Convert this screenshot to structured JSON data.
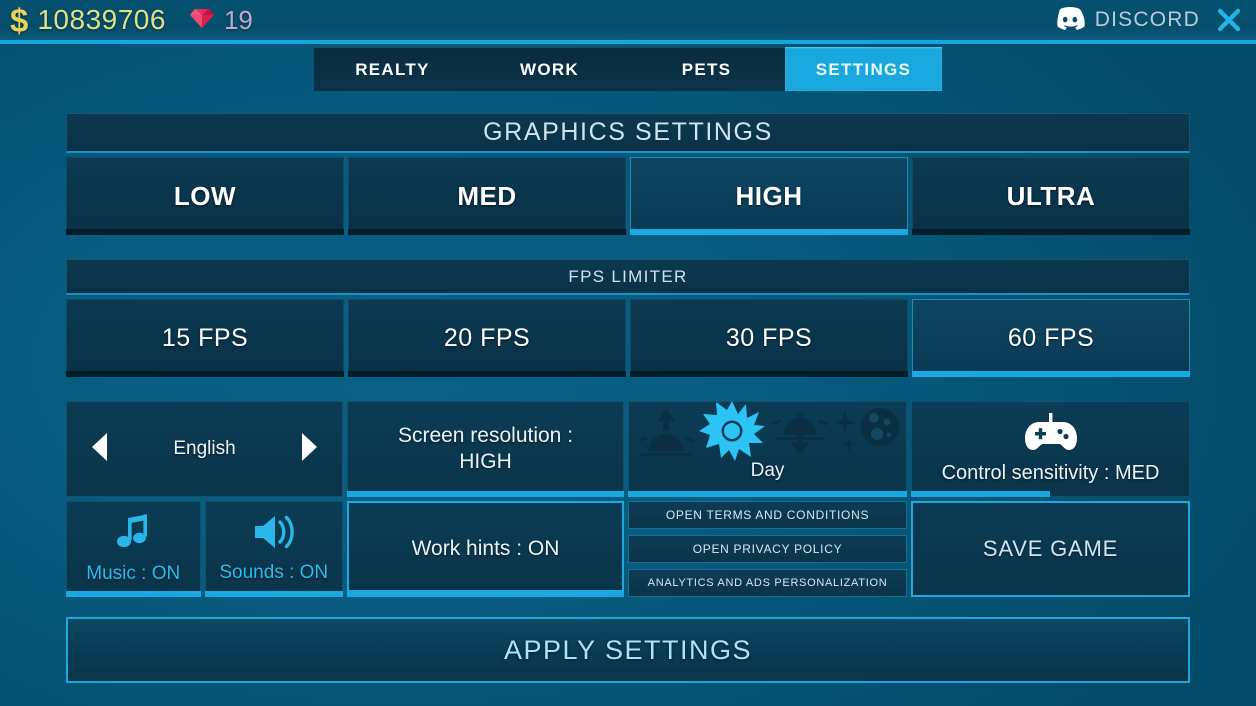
{
  "topbar": {
    "cash_icon": "dollar-icon",
    "cash": "10839706",
    "gem_icon": "gem-icon",
    "gems": "19",
    "discord_icon": "discord-icon",
    "discord_label": "DISCORD",
    "close_icon": "close-icon"
  },
  "tabs": [
    {
      "label": "REALTY",
      "active": false
    },
    {
      "label": "WORK",
      "active": false
    },
    {
      "label": "PETS",
      "active": false
    },
    {
      "label": "SETTINGS",
      "active": true
    }
  ],
  "graphics": {
    "header": "GRAPHICS SETTINGS",
    "options": [
      {
        "label": "LOW",
        "selected": false
      },
      {
        "label": "MED",
        "selected": false
      },
      {
        "label": "HIGH",
        "selected": true
      },
      {
        "label": "ULTRA",
        "selected": false
      }
    ]
  },
  "fps": {
    "header": "FPS LIMITER",
    "options": [
      {
        "label": "15 FPS",
        "selected": false
      },
      {
        "label": "20 FPS",
        "selected": false
      },
      {
        "label": "30 FPS",
        "selected": false
      },
      {
        "label": "60 FPS",
        "selected": true
      }
    ]
  },
  "language": {
    "prev_icon": "arrow-left-icon",
    "value": "English",
    "next_icon": "arrow-right-icon"
  },
  "resolution": {
    "line1": "Screen resolution :",
    "line2": "HIGH"
  },
  "daytime": {
    "label": "Day",
    "icons": [
      {
        "name": "sunrise-icon",
        "selected": false
      },
      {
        "name": "sun-icon",
        "selected": true
      },
      {
        "name": "sunset-icon",
        "selected": false
      },
      {
        "name": "moon-night-icon",
        "selected": false
      }
    ]
  },
  "sensitivity": {
    "icon": "gamepad-icon",
    "label": "Control sensitivity : MED",
    "fill_percent": 50
  },
  "music": {
    "icon": "music-note-icon",
    "label": "Music : ON"
  },
  "sounds": {
    "icon": "speaker-icon",
    "label": "Sounds : ON"
  },
  "work_hints": {
    "label": "Work hints : ON"
  },
  "legal": {
    "terms": "OPEN TERMS AND CONDITIONS",
    "privacy": "OPEN PRIVACY POLICY",
    "analytics": "ANALYTICS AND ADS PERSONALIZATION"
  },
  "save_game": {
    "label": "SAVE GAME"
  },
  "apply": {
    "label": "APPLY SETTINGS"
  },
  "colors": {
    "accent_cyan": "#19a9e0",
    "tab_active": "#18a8dd",
    "background": "#075b7e",
    "panel": "#0a3449",
    "cash_text": "#dfe08a",
    "gem_text": "#c2a8cf",
    "toggle_on": "#2fb9ec"
  }
}
